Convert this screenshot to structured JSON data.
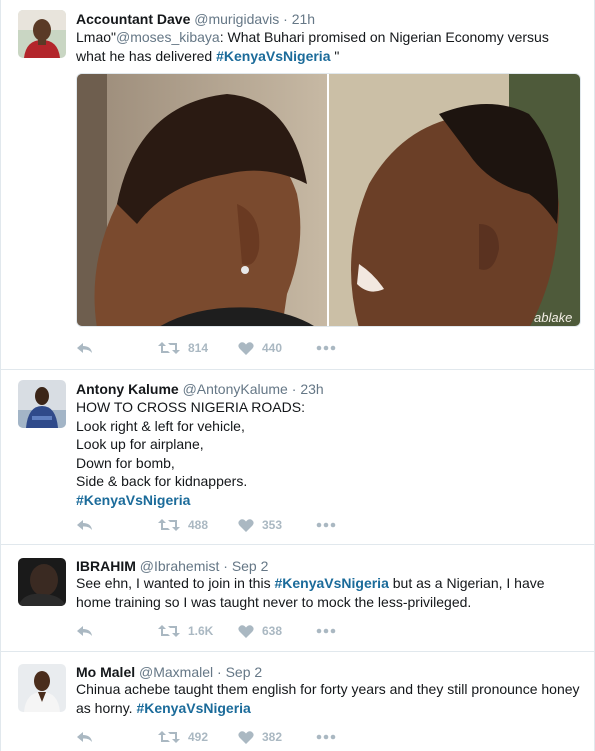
{
  "tweets": [
    {
      "name": "Accountant Dave",
      "handle": "@murigidavis",
      "dot": "·",
      "time": "21h",
      "text_parts": {
        "p1": "Lmao\"",
        "mention": "@moses_kibaya",
        "p2": ": What Buhari promised on Nigerian Economy versus",
        "p3": "what he has delivered ",
        "hashtag": "#KenyaVsNigeria",
        "p4": " \""
      },
      "media_watermark": "ablake",
      "retweets": "814",
      "likes": "440"
    },
    {
      "name": "Antony Kalume",
      "handle": "@AntonyKalume",
      "dot": "·",
      "time": "23h",
      "lines": [
        "HOW TO CROSS NIGERIA ROADS:",
        "Look right & left for vehicle,",
        "Look up for airplane,",
        "Down for bomb,",
        "Side & back for kidnappers."
      ],
      "hashtag": "#KenyaVsNigeria",
      "retweets": "488",
      "likes": "353"
    },
    {
      "name": "IBRAHIM",
      "handle": "@Ibrahemist",
      "dot": "·",
      "time": "Sep 2",
      "text_parts": {
        "p1": "See ehn, I wanted to join in this ",
        "hashtag": "#KenyaVsNigeria",
        "p2": " but as a Nigerian, I have",
        "p3": "home training so I was taught never to mock the less-privileged."
      },
      "retweets": "1.6K",
      "likes": "638"
    },
    {
      "name": "Mo Malel",
      "handle": "@Maxmalel",
      "dot": "·",
      "time": "Sep 2",
      "text_parts": {
        "p1": "Chinua achebe taught them english for forty years and they still pronounce honey",
        "p2": "as horny. ",
        "hashtag": "#KenyaVsNigeria"
      },
      "retweets": "492",
      "likes": "382"
    }
  ],
  "colors": {
    "hashtag": "#1b6b9a",
    "secondary_text": "#657786",
    "action_icon": "#aab8c2",
    "divider": "#e1e8ed"
  },
  "icons": [
    "reply-icon",
    "retweet-icon",
    "like-icon",
    "more-icon"
  ]
}
